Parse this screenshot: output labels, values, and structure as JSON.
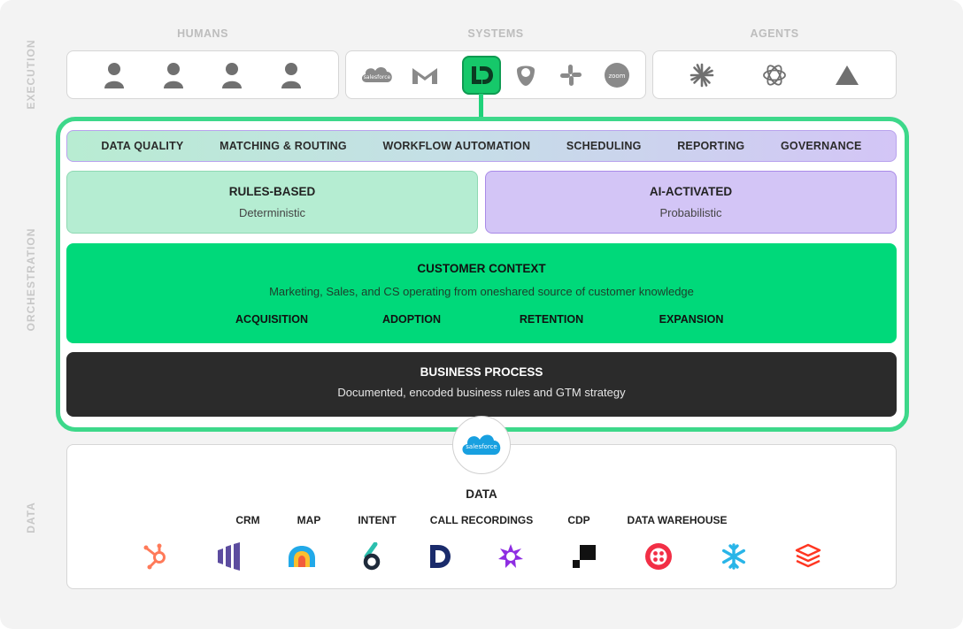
{
  "side_labels": {
    "execution": "EXECUTION",
    "orchestration": "ORCHESTRATION",
    "data": "DATA"
  },
  "execution": {
    "humans": {
      "heading": "HUMANS",
      "icons": [
        "person-icon",
        "person-icon",
        "person-icon",
        "person-icon"
      ]
    },
    "systems": {
      "heading": "SYSTEMS",
      "icons": [
        "salesforce-logo",
        "gmail-logo",
        "ld-logo",
        "outreach-logo",
        "slack-logo",
        "zoom-logo"
      ],
      "salesforce_text": "salesforce",
      "zoom_text": "zoom",
      "highlighted_logo": "LD"
    },
    "agents": {
      "heading": "AGENTS",
      "icons": [
        "claude-logo",
        "openai-logo",
        "triangle-logo"
      ]
    }
  },
  "capabilities": [
    "DATA QUALITY",
    "MATCHING & ROUTING",
    "WORKFLOW AUTOMATION",
    "SCHEDULING",
    "REPORTING",
    "GOVERNANCE"
  ],
  "modes": {
    "rules": {
      "title": "RULES-BASED",
      "subtitle": "Deterministic"
    },
    "ai": {
      "title": "AI-ACTIVATED",
      "subtitle": "Probabilistic"
    }
  },
  "customer_context": {
    "title": "CUSTOMER CONTEXT",
    "description": "Marketing, Sales, and CS operating from oneshared source of customer knowledge",
    "stages": [
      "ACQUISITION",
      "ADOPTION",
      "RETENTION",
      "EXPANSION"
    ]
  },
  "business_process": {
    "title": "BUSINESS PROCESS",
    "description": "Documented, encoded business rules and GTM strategy"
  },
  "data": {
    "hub_logo_text": "salesforce",
    "title": "DATA",
    "categories": [
      "CRM",
      "MAP",
      "INTENT",
      "CALL RECORDINGS",
      "CDP",
      "DATA WAREHOUSE"
    ],
    "vendors": [
      "hubspot-logo",
      "marketo-logo",
      "6sense-logo",
      "6sense-alt-logo",
      "dialpad-logo",
      "gong-logo",
      "segment-logo",
      "twilio-logo",
      "snowflake-logo",
      "databricks-logo"
    ]
  },
  "colors": {
    "accent_green": "#00d97a",
    "frame_green": "#3dd88a",
    "lavender": "#d3c5f6",
    "dark": "#2b2b2b",
    "muted": "#bdbdbd"
  }
}
